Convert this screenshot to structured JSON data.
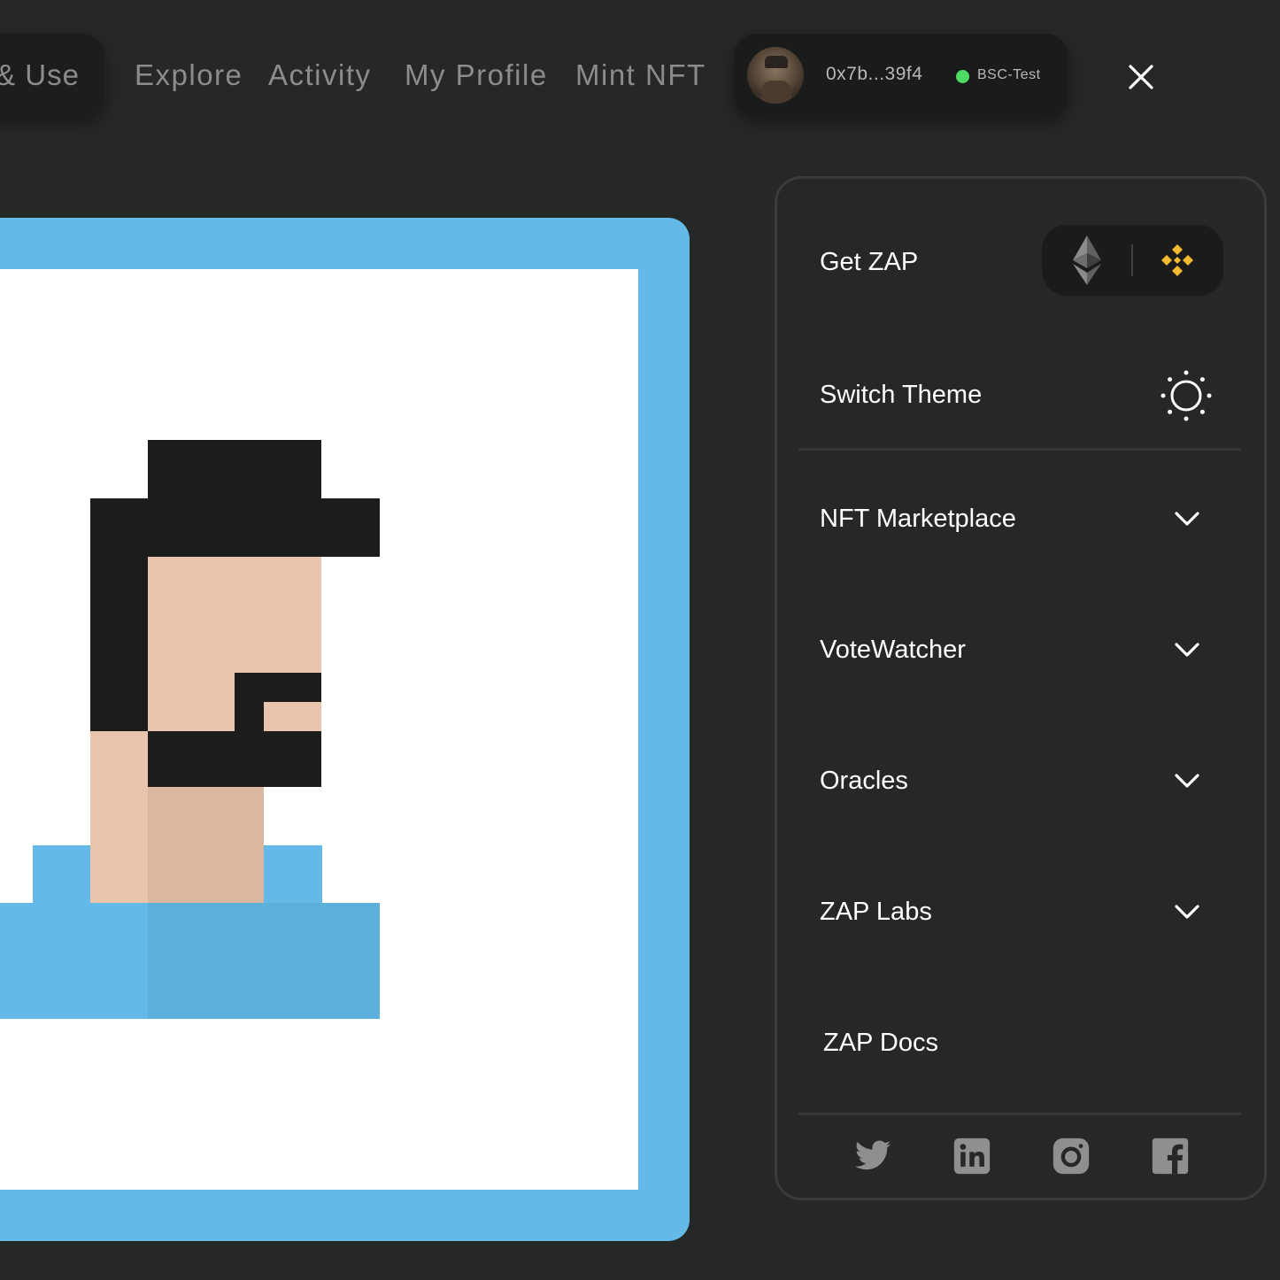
{
  "header": {
    "truncated_tab": "s & Use",
    "nav": [
      "Explore",
      "Activity",
      "My Profile",
      "Mint NFT"
    ],
    "wallet": {
      "address": "0x7b...39f4",
      "network": "BSC-Test",
      "network_status_color": "#4cd964"
    },
    "close_icon": "close-icon"
  },
  "nft_preview": {
    "frame_color": "#63b9e7",
    "background_color": "#ffffff",
    "colors": {
      "hair": "#1c1c1c",
      "skin": "#e8c5ac",
      "skin_shadow": "#dcb79f",
      "shirt": "#63b9e7",
      "shirt_shadow": "#5db0dc"
    }
  },
  "menu": {
    "get_zap": {
      "label": "Get ZAP",
      "chain_icons": [
        "ethereum-icon",
        "binance-icon"
      ],
      "binance_color": "#f3ba2f"
    },
    "switch_theme": {
      "label": "Switch Theme",
      "icon": "sun-icon"
    },
    "items": [
      {
        "label": "NFT Marketplace",
        "icon": "chevron-down-icon"
      },
      {
        "label": "VoteWatcher",
        "icon": "chevron-down-icon"
      },
      {
        "label": "Oracles",
        "icon": "chevron-down-icon"
      },
      {
        "label": "ZAP Labs",
        "icon": "chevron-down-icon"
      }
    ],
    "docs": {
      "label": "ZAP Docs"
    },
    "socials": [
      "twitter-icon",
      "linkedin-icon",
      "instagram-icon",
      "facebook-icon"
    ]
  }
}
